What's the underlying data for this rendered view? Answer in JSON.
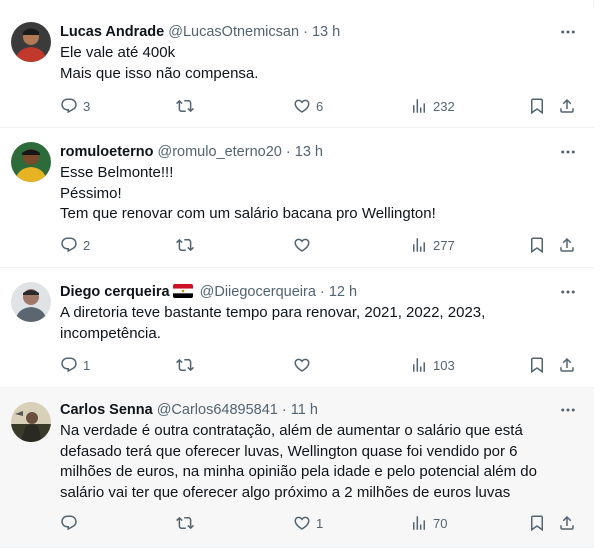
{
  "tweets": [
    {
      "name": "Lucas Andrade",
      "handle": "@LucasOtnemicsan",
      "sep": "·",
      "time": "13 h",
      "lines": [
        "Ele vale até 400k",
        "Mais que isso não compensa."
      ],
      "replies": "3",
      "retweets": "",
      "likes": "6",
      "views": "232",
      "avatar_colors": [
        "#2b2b2b",
        "#c0392b"
      ]
    },
    {
      "name": "romuloeterno",
      "handle": "@romulo_eterno20",
      "sep": "·",
      "time": "13 h",
      "lines": [
        "Esse Belmonte!!!",
        "Péssimo!",
        "Tem que renovar com um salário bacana pro Wellington!"
      ],
      "replies": "2",
      "retweets": "",
      "likes": "",
      "views": "277",
      "avatar_colors": [
        "#1f5e2e",
        "#e6b422"
      ]
    },
    {
      "name": "Diego cerqueira",
      "handle": "@Diiegocerqueira",
      "sep": "·",
      "time": "12 h",
      "lines": [
        "A diretoria teve bastante tempo para renovar, 2021, 2022, 2023,",
        "incompetência."
      ],
      "replies": "1",
      "retweets": "",
      "likes": "",
      "views": "103",
      "avatar_colors": [
        "#9aa3a8",
        "#e9e9e9"
      ]
    },
    {
      "name": "Carlos Senna",
      "handle": "@Carlos64895841",
      "sep": "·",
      "time": "11 h",
      "lines": [
        "Na verdade é outra contratação, além de aumentar o salário que está",
        "defasado terá que oferecer luvas, Wellington quase foi vendido por 6",
        "milhões de euros, na minha opinião pela idade e pelo potencial além do",
        "salário vai ter que oferecer algo próximo a 2 milhões de euros luvas"
      ],
      "replies": "",
      "retweets": "",
      "likes": "1",
      "views": "70",
      "avatar_colors": [
        "#3a3a2a",
        "#d8d0b8"
      ]
    }
  ],
  "colors": {
    "text": "#0f1419",
    "muted": "#536471",
    "divider": "#eff3f4",
    "highlight_bg": "#f7f7f7",
    "flag_red": "#ce1126",
    "flag_white": "#ffffff",
    "flag_black": "#000000"
  },
  "icons": [
    "more-icon",
    "reply-icon",
    "retweet-icon",
    "like-icon",
    "views-icon",
    "bookmark-icon",
    "share-icon",
    "egypt-flag-icon"
  ]
}
